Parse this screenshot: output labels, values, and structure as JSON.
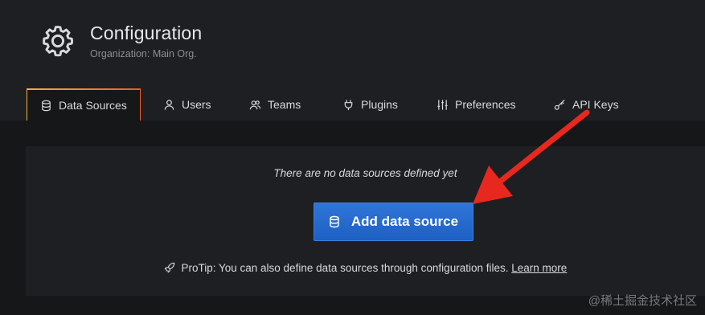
{
  "header": {
    "title": "Configuration",
    "subtitle": "Organization: Main Org.",
    "icon": "gear-icon"
  },
  "tabs": [
    {
      "label": "Data Sources",
      "icon": "database-icon",
      "active": true
    },
    {
      "label": "Users",
      "icon": "user-icon",
      "active": false
    },
    {
      "label": "Teams",
      "icon": "users-icon",
      "active": false
    },
    {
      "label": "Plugins",
      "icon": "plug-icon",
      "active": false
    },
    {
      "label": "Preferences",
      "icon": "sliders-icon",
      "active": false
    },
    {
      "label": "API Keys",
      "icon": "key-icon",
      "active": false
    }
  ],
  "main": {
    "empty_message": "There are no data sources defined yet",
    "add_button_label": "Add data source",
    "protip_text": "ProTip: You can also define data sources through configuration files.",
    "protip_link": "Learn more"
  },
  "watermark": "@稀土掘金技术社区",
  "colors": {
    "background": "#161719",
    "panel": "#1e1f22",
    "primary_button": "#1f60c4",
    "annotation_arrow": "#e8281e",
    "tab_accent": "#f05a28"
  }
}
